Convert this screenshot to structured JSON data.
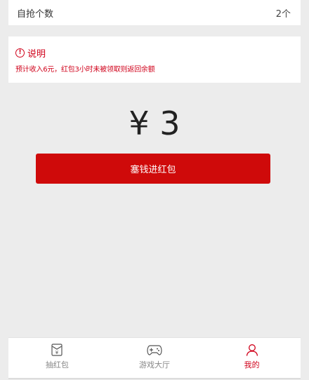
{
  "self_grab": {
    "label": "自抢个数",
    "value": "2个"
  },
  "note": {
    "title": "说明",
    "text": "预计收入6元，红包3小时未被领取则返回余额"
  },
  "amount": "¥ 3",
  "submit_label": "塞钱进红包",
  "tabs": [
    {
      "label": "抽红包",
      "icon": "red-envelope-icon",
      "active": false
    },
    {
      "label": "游戏大厅",
      "icon": "gamepad-icon",
      "active": false
    },
    {
      "label": "我的",
      "icon": "user-icon",
      "active": true
    }
  ],
  "colors": {
    "accent": "#d0021b",
    "button": "#cf0a0a",
    "background": "#ececec"
  }
}
